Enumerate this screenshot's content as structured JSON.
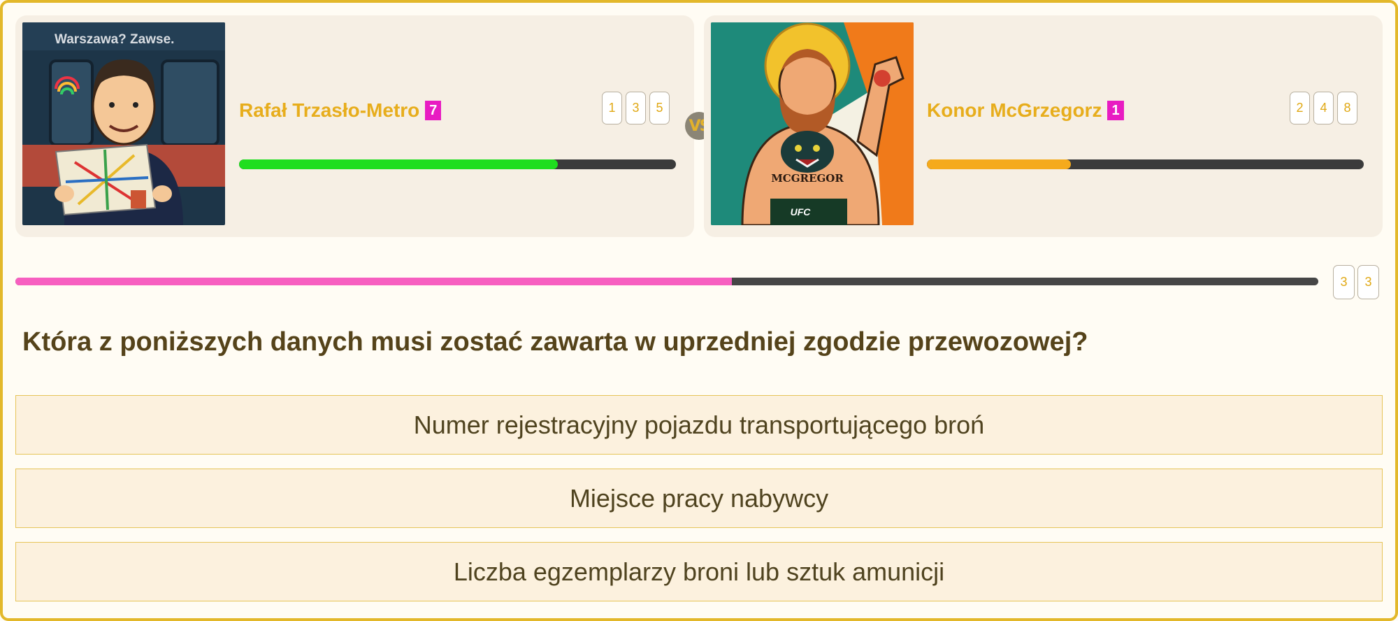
{
  "players": [
    {
      "name": "Rafał Trzasło-Metro",
      "badge": "7",
      "tiles": [
        "1",
        "3",
        "5"
      ],
      "progress": 0.73,
      "bar_color": "#1fde1f",
      "portrait_text": "Warszawa? Zawse."
    },
    {
      "name": "Konor McGrzegorz",
      "badge": "1",
      "tiles": [
        "2",
        "4",
        "8"
      ],
      "progress": 0.33,
      "bar_color": "#f5aa1c",
      "portrait_text": "MCGREGOR",
      "portrait_text2": "UFC"
    }
  ],
  "vs_label": "VS",
  "question_progress": 0.55,
  "question_counter": [
    "3",
    "3"
  ],
  "question": "Która z poniższych danych musi zostać zawarta w uprzedniej zgodzie przewozowej?",
  "answers": [
    "Numer rejestracyjny pojazdu transportującego broń",
    "Miejsce pracy nabywcy",
    "Liczba egzemplarzy broni lub sztuk amunicji"
  ],
  "colors": {
    "accent": "#e3b82a",
    "badge": "#e81cc2",
    "main_progress": "#f75fc0"
  }
}
